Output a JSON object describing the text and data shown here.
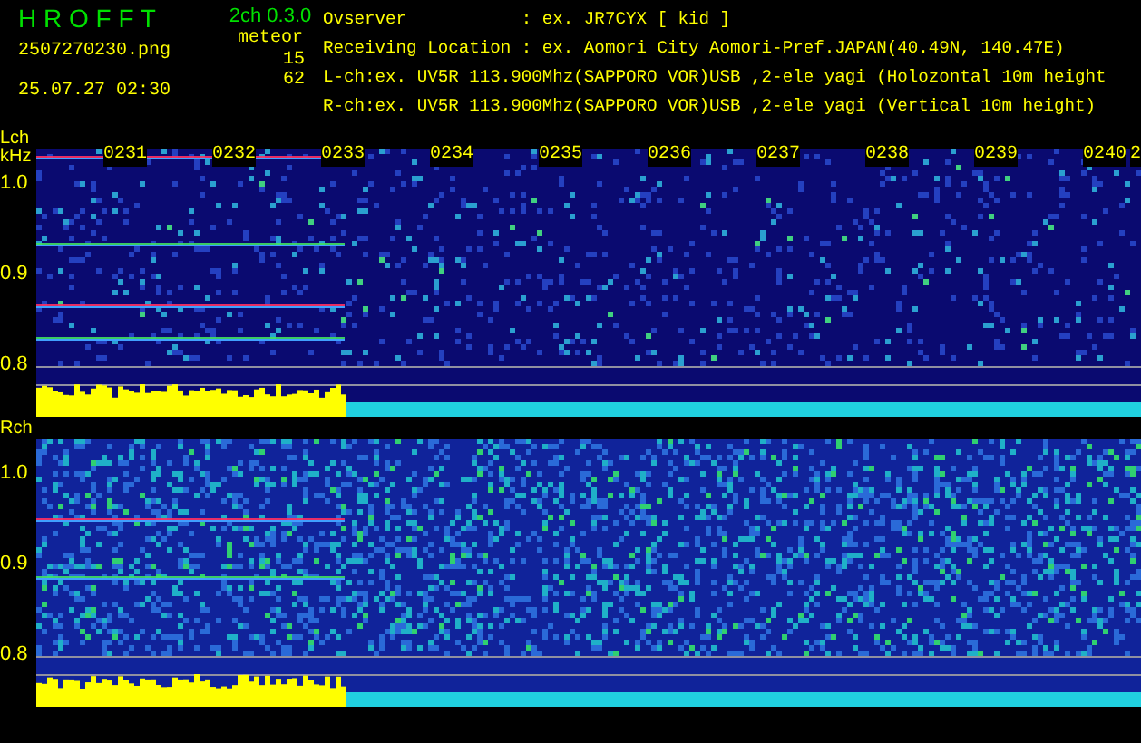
{
  "header": {
    "title": "H R O F F T",
    "version": "2ch 0.3.0",
    "filename": "2507270230.png",
    "datetime": "25.07.27 02:30",
    "meteor_label": "meteor",
    "meteor_counts": [
      "15",
      "62"
    ],
    "info_lines": [
      "Ovserver           : ex. JR7CYX [ kid ]",
      "Receiving Location : ex. Aomori City Aomori-Pref.JAPAN(40.49N, 140.47E)",
      "L-ch:ex. UV5R 113.900Mhz(SAPPORO VOR)USB ,2-ele yagi (Holozontal 10m height",
      "R-ch:ex. UV5R 113.900Mhz(SAPPORO VOR)USB ,2-ele yagi (Vertical 10m height)"
    ]
  },
  "panels": [
    {
      "channel": "Lch",
      "unit": "kHz",
      "yticks": [
        "1.0",
        "0.9",
        "0.8"
      ],
      "time_labels": [
        "0231",
        "0232",
        "0233",
        "0234",
        "0235",
        "0236",
        "0237",
        "0238",
        "0239",
        "0240",
        "2"
      ]
    },
    {
      "channel": "Rch",
      "yticks": [
        "1.0",
        "0.9",
        "0.8"
      ]
    }
  ]
}
